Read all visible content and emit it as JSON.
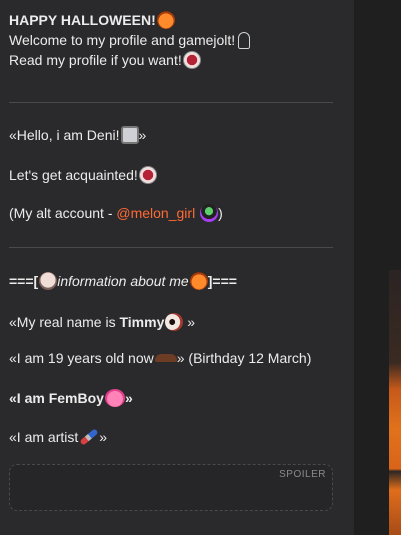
{
  "profile": {
    "header_title": "HAPPY HALLOWEEN!",
    "welcome_text": "Welcome to my profile and gamejolt!",
    "read_text": "Read my profile if you want!",
    "hello_text": "«Hello, i am Deni!",
    "hello_close": "»",
    "acquainted_text": "Let's get acquainted!",
    "alt_prefix": "(My alt account - ",
    "alt_link": "@melon_girl",
    "alt_suffix": ")",
    "info_prefix": "===[",
    "info_text": "information about me",
    "info_suffix": "]===",
    "realname_prefix": "«My real name is ",
    "realname_value": "Timmy",
    "realname_suffix": "»",
    "age_text": "«I am 19 years old now",
    "age_suffix": "» (Birthday 12 March)",
    "femboy_text": "«I am FemBoy",
    "femboy_suffix": "»",
    "artist_text": "«I am artist",
    "artist_suffix": "»",
    "spoiler_label": "SPOILER"
  },
  "colors": {
    "background": "#2a2a2c",
    "link": "#ff6a34",
    "text": "#ececec"
  }
}
